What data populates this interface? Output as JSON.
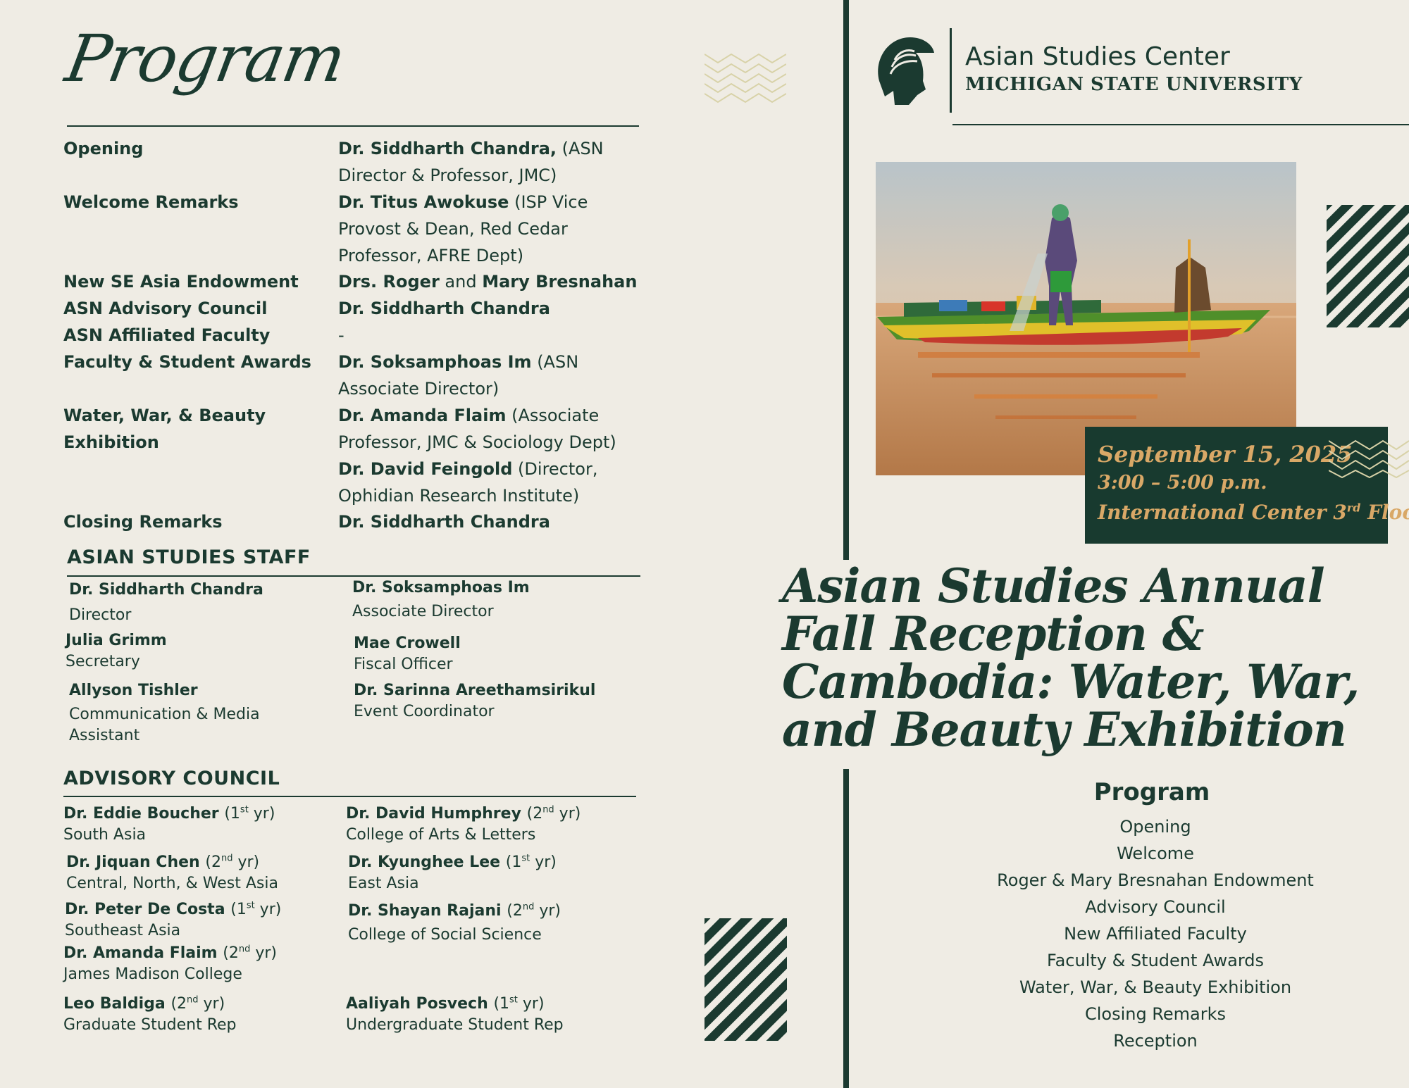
{
  "left": {
    "script_title": "Program",
    "program": [
      {
        "label": "Opening",
        "name": "Dr. Siddharth Chandra,",
        "detail": " (ASN Director & Professor, JMC)"
      },
      {
        "label": "Welcome Remarks",
        "name": "Dr. Titus Awokuse",
        "detail": " (ISP Vice Provost & Dean, Red Cedar Professor, AFRE Dept)"
      },
      {
        "label": "New SE Asia Endowment",
        "name": "Drs. Roger",
        "mid": " and ",
        "name2": "Mary Bresnahan",
        "detail": ""
      },
      {
        "label": "ASN Advisory Council",
        "name": "Dr. Siddharth Chandra",
        "detail": ""
      },
      {
        "label": "ASN Affiliated Faculty",
        "name": "",
        "detail": "-"
      },
      {
        "label": "Faculty & Student Awards",
        "name": "Dr. Soksamphoas Im",
        "detail": " (ASN Associate Director)"
      },
      {
        "label": "Water, War, & Beauty Exhibition",
        "name": "Dr. Amanda Flaim",
        "detail": " (Associate Professor, JMC & Sociology Dept)"
      },
      {
        "label": "",
        "name": "Dr. David Feingold",
        "detail": " (Director, Ophidian Research Institute)"
      },
      {
        "label": "Closing Remarks",
        "name": "Dr. Siddharth Chandra",
        "detail": ""
      }
    ],
    "staff_heading": "ASIAN STUDIES STAFF",
    "staff": [
      {
        "name": "Dr. Siddharth Chandra",
        "role": "Director"
      },
      {
        "name": "Dr. Soksamphoas Im",
        "role": "Associate Director"
      },
      {
        "name": "Julia Grimm",
        "role": "Secretary"
      },
      {
        "name": "Mae Crowell",
        "role": "Fiscal Officer"
      },
      {
        "name": "Allyson Tishler",
        "role": "Communication & Media Assistant"
      },
      {
        "name": "Dr. Sarinna Areethamsirikul",
        "role": "Event Coordinator"
      }
    ],
    "council_heading": "ADVISORY COUNCIL",
    "council": [
      {
        "name": "Dr. Eddie Boucher",
        "yr_num": "1",
        "yr_sup": "st",
        "yr_tail": " yr)",
        "area": "South Asia"
      },
      {
        "name": "Dr. David Humphrey",
        "yr_num": "2",
        "yr_sup": "nd",
        "yr_tail": " yr)",
        "area": "College of Arts & Letters"
      },
      {
        "name": "Dr. Jiquan Chen",
        "yr_num": "2",
        "yr_sup": "nd",
        "yr_tail": " yr)",
        "area": "Central, North, & West Asia"
      },
      {
        "name": "Dr. Kyunghee Lee",
        "yr_num": "1",
        "yr_sup": "st",
        "yr_tail": " yr)",
        "area": "East Asia"
      },
      {
        "name": "Dr. Peter De Costa",
        "yr_num": "1",
        "yr_sup": "st",
        "yr_tail": " yr)",
        "area": "Southeast Asia"
      },
      {
        "name": "Dr. Shayan Rajani",
        "yr_num": "2",
        "yr_sup": "nd",
        "yr_tail": " yr)",
        "area": "College of Social Science"
      },
      {
        "name": "Dr. Amanda Flaim",
        "yr_num": "2",
        "yr_sup": "nd",
        "yr_tail": " yr)",
        "area": "James Madison College"
      },
      {
        "name": "Leo Baldiga",
        "yr_num": "2",
        "yr_sup": "nd",
        "yr_tail": " yr)",
        "area": "Graduate Student Rep"
      },
      {
        "name": "Aaliyah Posvech",
        "yr_num": "1",
        "yr_sup": "st",
        "yr_tail": " yr)",
        "area": "Undergraduate Student Rep"
      }
    ]
  },
  "right": {
    "center_name": "Asian Studies Center",
    "university": "MICHIGAN STATE UNIVERSITY",
    "date": "September 15, 2025",
    "time": "3:00 – 5:00 p.m.",
    "location_pre": "International Center 3",
    "location_sup": "rd",
    "location_post": " Floor",
    "title_lines": [
      "Asian Studies Annual",
      "Fall Reception &",
      "Cambodia: Water, War,",
      "and Beauty Exhibition"
    ],
    "program_heading": "Program",
    "program_items": [
      "Opening",
      "Welcome",
      "Roger & Mary Bresnahan Endowment",
      "Advisory Council",
      "New Affiliated Faculty",
      "Faculty & Student Awards",
      "Water, War, & Beauty Exhibition",
      "Closing Remarks",
      "Reception"
    ]
  },
  "colors": {
    "primary": "#1b3a30",
    "background": "#efece4",
    "accent": "#d9a867"
  }
}
